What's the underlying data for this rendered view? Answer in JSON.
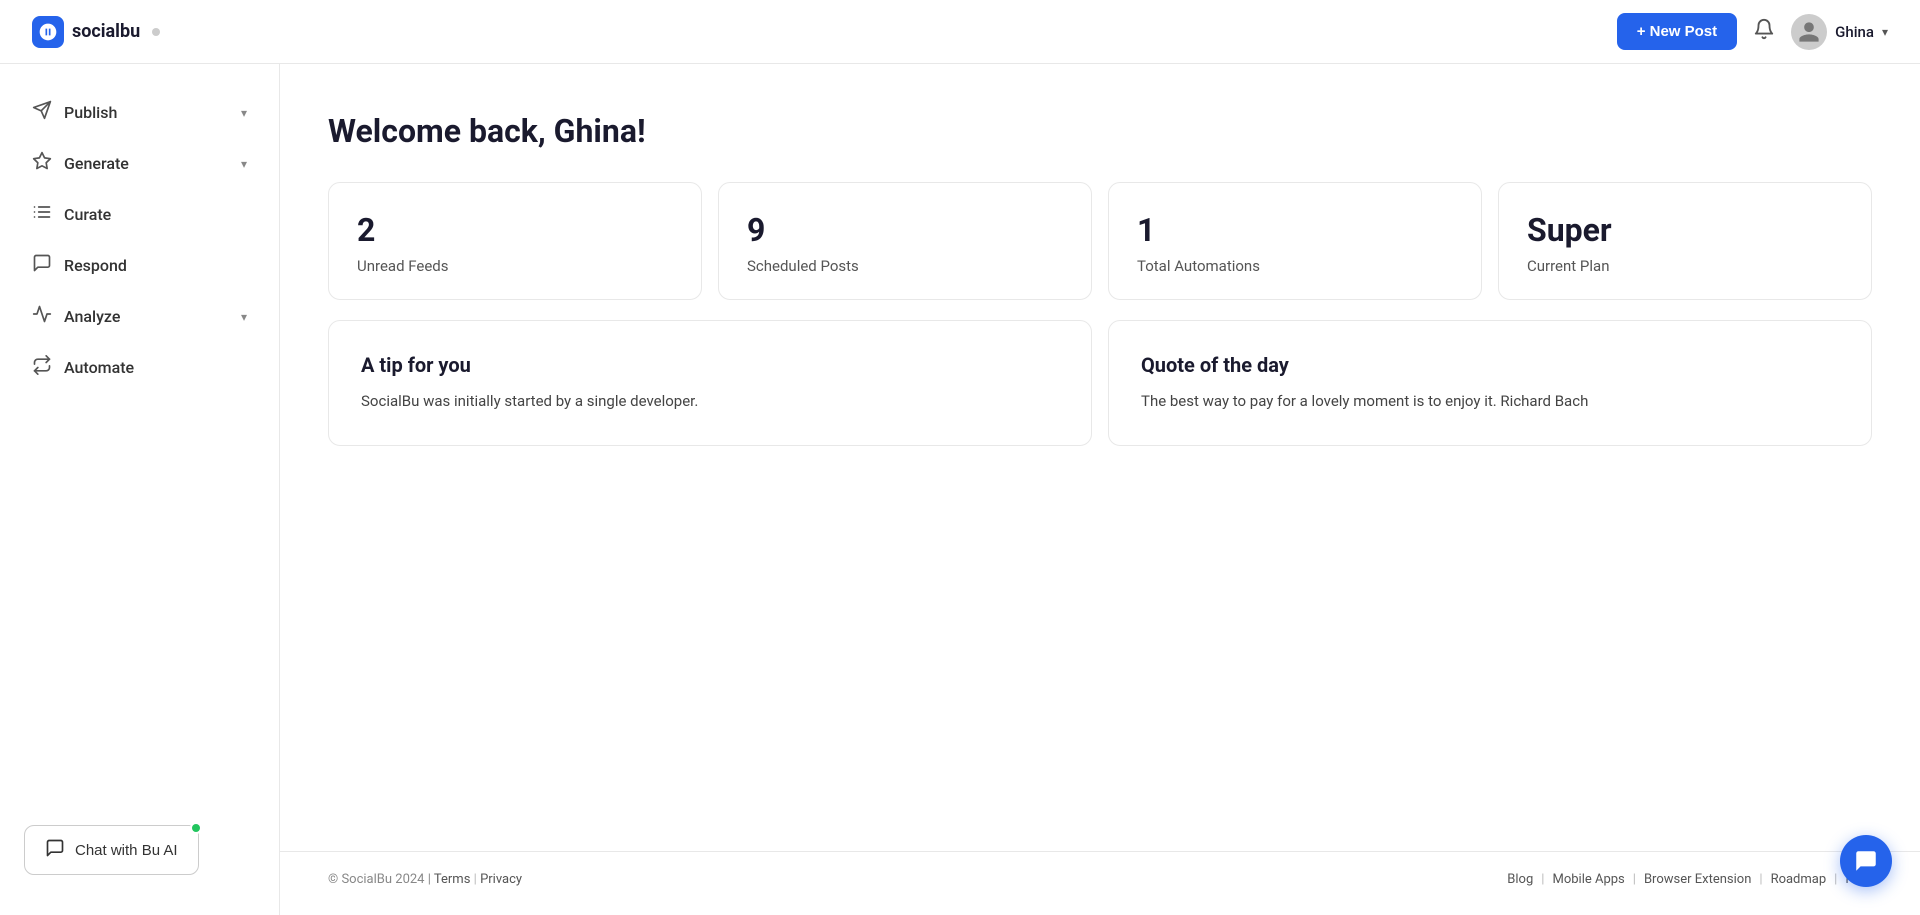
{
  "header": {
    "logo_text": "socialbu",
    "logo_dot": true,
    "new_post_label": "+ New Post",
    "username": "Ghina"
  },
  "sidebar": {
    "items": [
      {
        "id": "publish",
        "label": "Publish",
        "icon": "send-icon",
        "has_chevron": true
      },
      {
        "id": "generate",
        "label": "Generate",
        "icon": "star-icon",
        "has_chevron": true
      },
      {
        "id": "curate",
        "label": "Curate",
        "icon": "list-icon",
        "has_chevron": false
      },
      {
        "id": "respond",
        "label": "Respond",
        "icon": "message-icon",
        "has_chevron": false
      },
      {
        "id": "analyze",
        "label": "Analyze",
        "icon": "chart-icon",
        "has_chevron": true
      },
      {
        "id": "automate",
        "label": "Automate",
        "icon": "refresh-icon",
        "has_chevron": false
      }
    ],
    "chat_btn_label": "Chat with Bu AI"
  },
  "main": {
    "welcome_title": "Welcome back, Ghina!",
    "stats": [
      {
        "number": "2",
        "label": "Unread Feeds"
      },
      {
        "number": "9",
        "label": "Scheduled Posts"
      },
      {
        "number": "1",
        "label": "Total Automations"
      },
      {
        "number": "Super",
        "label": "Current Plan"
      }
    ],
    "info_cards": [
      {
        "title": "A tip for you",
        "text": "SocialBu was initially started by a single developer."
      },
      {
        "title": "Quote of the day",
        "text": "The best way to pay for a lovely moment is to enjoy it. Richard Bach"
      }
    ]
  },
  "footer": {
    "copyright": "© SocialBu 2024 |",
    "links": [
      {
        "label": "Terms"
      },
      {
        "label": "Privacy"
      }
    ],
    "right_links": [
      {
        "label": "Blog"
      },
      {
        "label": "Mobile Apps"
      },
      {
        "label": "Browser Extension"
      },
      {
        "label": "Roadmap"
      },
      {
        "label": "Help"
      }
    ]
  }
}
